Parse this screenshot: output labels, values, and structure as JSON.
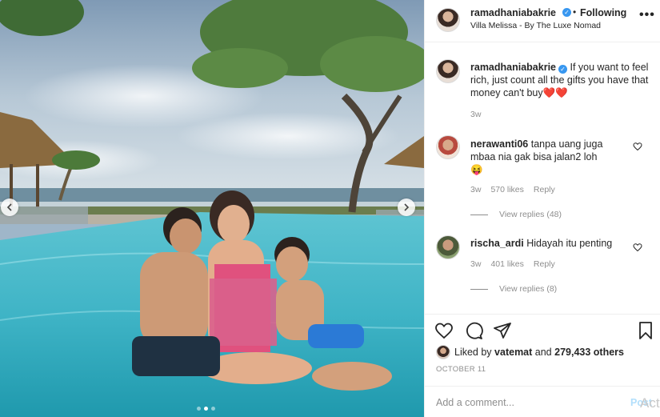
{
  "post": {
    "username": "ramadhaniabakrie",
    "separator": "•",
    "follow_label": "Following",
    "location": "Villa Melissa - By The Luxe Nomad",
    "more_icon": "•••"
  },
  "caption": {
    "username": "ramadhaniabakrie",
    "text": "If you want to feel rich, just count all the gifts you have that money can't buy",
    "emoji": "❤️❤️",
    "time": "3w"
  },
  "comments": [
    {
      "username": "nerawanti06",
      "text": "tanpa uang juga mbaa nia gak bisa jalan2 loh",
      "emoji": "😝",
      "time": "3w",
      "likes": "570 likes",
      "reply_label": "Reply",
      "view_replies": "View replies (48)"
    },
    {
      "username": "rischa_ardi",
      "text": "Hidayah itu penting",
      "time": "3w",
      "likes": "401 likes",
      "reply_label": "Reply",
      "view_replies": "View replies (8)"
    }
  ],
  "likes": {
    "prefix": "Liked by",
    "user": "vatemat",
    "middle": "and",
    "count": "279,433 others"
  },
  "date": "OCTOBER 11",
  "add_comment": {
    "placeholder": "Add a comment...",
    "post_label": "Post"
  },
  "watermark": "Act",
  "colors": {
    "link_blue": "#3897f0",
    "post_disabled": "#b2dffc",
    "muted_text": "#8e8e8e",
    "heart_red": "#ed4956"
  },
  "icons": {
    "like": "heart-outline-icon",
    "comment": "speech-bubble-icon",
    "share": "paper-plane-icon",
    "save": "bookmark-icon"
  },
  "carousel": {
    "total": 3,
    "active": 2
  }
}
